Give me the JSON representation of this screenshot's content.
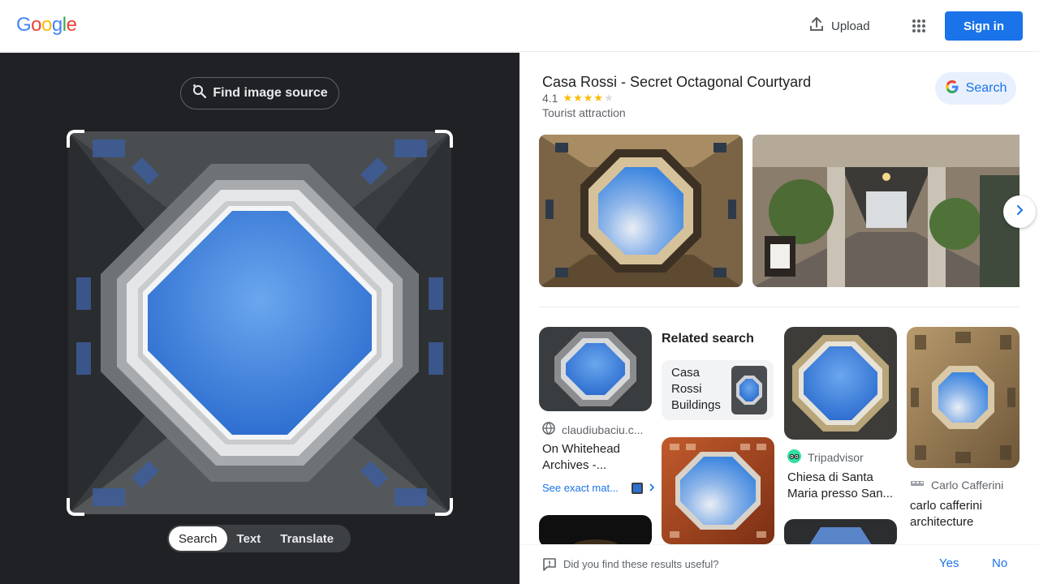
{
  "header": {
    "logo": [
      "G",
      "o",
      "o",
      "g",
      "l",
      "e"
    ],
    "logo_colors": [
      "#4285f4",
      "#ea4335",
      "#fbbc05",
      "#4285f4",
      "#34a853",
      "#ea4335"
    ],
    "upload_label": "Upload",
    "signin_label": "Sign in"
  },
  "left": {
    "find_source_label": "Find image source",
    "modes": [
      "Search",
      "Text",
      "Translate"
    ],
    "active_mode": "Search"
  },
  "place": {
    "title": "Casa Rossi - Secret Octagonal Courtyard",
    "rating": "4.1",
    "stars_filled": 4,
    "stars_total": 5,
    "type": "Tourist attraction",
    "search_label": "Search"
  },
  "results": {
    "card1": {
      "source": "claudiubaciu.c...",
      "title": "On Whitehead Archives -...",
      "exact_label": "See exact mat..."
    },
    "related": {
      "heading": "Related search",
      "label": "Casa Rossi Buildings"
    },
    "card3": {
      "source": "Tripadvisor",
      "title": "Chiesa di Santa Maria presso San..."
    },
    "card4": {
      "source": "Carlo Cafferini",
      "title": "carlo cafferini architecture"
    }
  },
  "feedback": {
    "question": "Did you find these results useful?",
    "yes": "Yes",
    "no": "No"
  },
  "colors": {
    "accent": "#1a73e8",
    "dark_bg": "#202124",
    "star": "#fbbc04"
  }
}
